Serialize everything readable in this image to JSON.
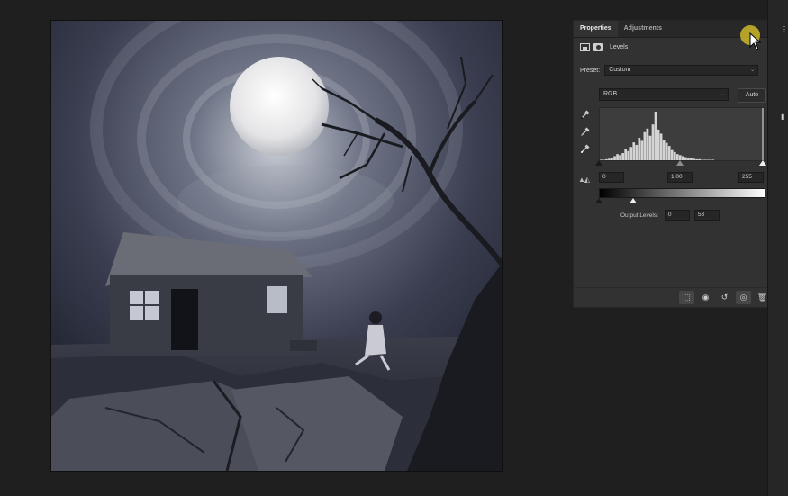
{
  "panel": {
    "tabs": [
      {
        "label": "Properties",
        "active": true
      },
      {
        "label": "Adjustments",
        "active": false
      }
    ],
    "menu_icon": "panel-menu-icon",
    "title": "Levels",
    "preset_label": "Preset:",
    "preset_value": "Custom",
    "channel_value": "RGB",
    "auto_label": "Auto",
    "input_black": "0",
    "input_gamma": "1.00",
    "input_white": "255",
    "output_label": "Output Levels:",
    "output_black": "0",
    "output_white": "53",
    "eyedropper_icons": [
      "black-eyedropper-icon",
      "gray-eyedropper-icon",
      "white-eyedropper-icon"
    ],
    "footer_icons": [
      "clip-to-layer-icon",
      "view-previous-state-icon",
      "reset-icon",
      "toggle-visibility-icon",
      "delete-icon"
    ]
  },
  "histogram": {
    "bins": [
      1,
      1,
      2,
      3,
      5,
      8,
      12,
      10,
      14,
      22,
      18,
      26,
      35,
      30,
      44,
      38,
      55,
      62,
      48,
      70,
      95,
      60,
      52,
      40,
      34,
      28,
      20,
      16,
      12,
      10,
      8,
      6,
      5,
      4,
      3,
      2,
      2,
      1,
      1,
      1,
      1,
      1,
      0,
      0,
      0,
      0,
      0,
      0,
      0,
      0,
      0,
      0,
      0,
      0,
      0,
      0,
      0,
      0,
      0,
      0
    ],
    "color": "#d4d4d4"
  },
  "colors": {
    "accent_cursor": "#cdb928",
    "panel_bg": "#323232",
    "app_bg": "#1f1f1f"
  }
}
